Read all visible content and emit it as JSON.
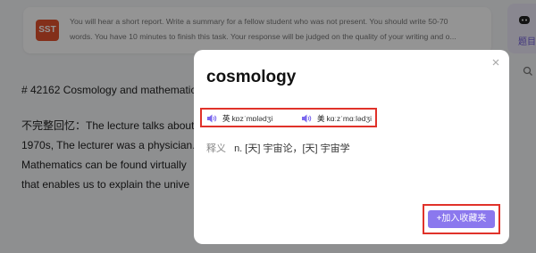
{
  "instruction": {
    "badge": "SST",
    "line1": "You will hear a short report. Write a summary for a fellow student who was not present. You should write 50-70",
    "line2": "words. You have 10 minutes to finish this task. Your response will be judged on the quality of your writing and o..."
  },
  "side_panel": {
    "label": "题目"
  },
  "question": {
    "title": "# 42162 Cosmology and mathematic",
    "lines": [
      "不完整回忆：The lecture talks about",
      "1970s, The lecturer was a physician.",
      "Mathematics can be found virtually",
      "that enables us to explain the unive"
    ]
  },
  "dialog": {
    "word": "cosmology",
    "uk_label": "英",
    "uk_ipa": "kɒzˈmɒlədʒi",
    "us_label": "美",
    "us_ipa": "kɑːzˈmɑːlədʒi",
    "meaning_label": "释义",
    "meaning": "n. [天] 宇宙论，[天] 宇宙学",
    "favorite_label": "+加入收藏夹"
  },
  "colors": {
    "accent": "#8b78ee",
    "badge": "#e2522e",
    "highlight_border": "#e0322a"
  }
}
